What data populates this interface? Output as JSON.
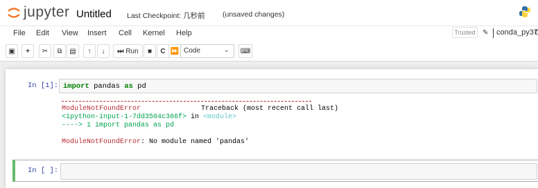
{
  "header": {
    "logo_text": "jupyter",
    "notebook_name": "Untitled",
    "checkpoint": "Last Checkpoint: 几秒前",
    "unsaved": "(unsaved changes)"
  },
  "menu": {
    "items": [
      "File",
      "Edit",
      "View",
      "Insert",
      "Cell",
      "Kernel",
      "Help"
    ],
    "trusted": "Trusted",
    "kernel_name": "conda_py37",
    "kernel_indicator": "O"
  },
  "toolbar": {
    "run_label": "Run",
    "cell_type": "Code"
  },
  "cells": [
    {
      "prompt": "In  [1]:",
      "code_keyword_1": "import",
      "code_middle": " pandas ",
      "code_keyword_2": "as",
      "code_end": " pd",
      "output": {
        "error_name": "ModuleNotFoundError",
        "traceback_header": "Traceback (most recent call last)",
        "location": "<ipython-input-1-7dd3504c366f>",
        "location_in": " in ",
        "location_module": "<module>",
        "arrow": "----> 1 import pandas as pd",
        "error_name_2": "ModuleNotFoundError",
        "error_message": ": No module named 'pandas'"
      }
    },
    {
      "prompt": "In  [ ]:"
    }
  ],
  "colors": {
    "prompt_in": "#303f9f",
    "error_red": "#b22b31",
    "trace_green": "#00a250",
    "selected_cell": "#66bb6a"
  }
}
